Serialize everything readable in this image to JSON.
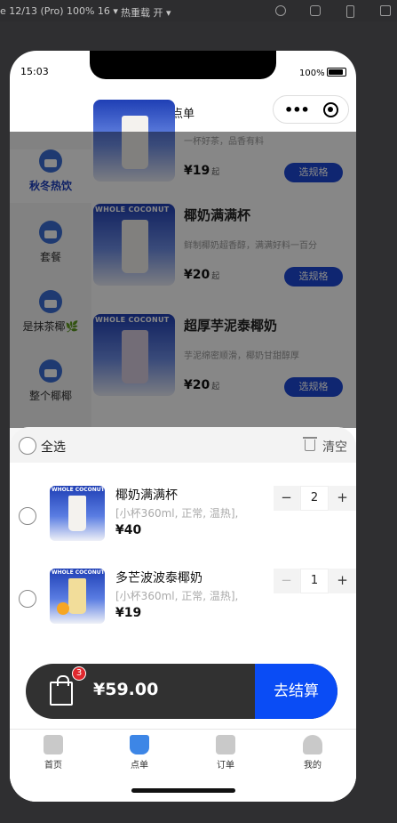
{
  "devtools": {
    "device": "e 12/13 (Pro) 100% 16 ▾",
    "hotreload": "热重载 开 ▾"
  },
  "status": {
    "time": "15:03",
    "battery": "100%"
  },
  "nav": {
    "title": "点单"
  },
  "categories": [
    {
      "label": "秋冬热饮",
      "active": true
    },
    {
      "label": "套餐",
      "active": false
    },
    {
      "label": "是抹茶椰🌿",
      "active": false
    },
    {
      "label": "整个椰椰",
      "active": false
    }
  ],
  "products": [
    {
      "name": "",
      "desc": "一杯好茶，品香有料",
      "price": "¥19",
      "price_suffix": "起",
      "spec": "选规格",
      "brand": ""
    },
    {
      "name": "椰奶满满杯",
      "desc": "鲜制椰奶超香醇，满满好料一百分",
      "price": "¥20",
      "price_suffix": "起",
      "spec": "选规格",
      "brand": "WHOLE COCONUT"
    },
    {
      "name": "超厚芋泥泰椰奶",
      "desc": "芋泥绵密顺滑，椰奶甘甜醇厚",
      "price": "¥20",
      "price_suffix": "起",
      "spec": "选规格",
      "brand": "WHOLE COCONUT"
    }
  ],
  "cart": {
    "select_all": "全选",
    "clear": "清空",
    "items": [
      {
        "name": "椰奶满满杯",
        "spec": "[小杯360ml, 正常, 温热],",
        "price": "¥40",
        "qty": "2",
        "brand": "WHOLE COCONUT"
      },
      {
        "name": "多芒波波泰椰奶",
        "spec": "[小杯360ml, 正常, 温热],",
        "price": "¥19",
        "qty": "1",
        "brand": "WHOLE COCONUT"
      }
    ],
    "stepper": {
      "minus": "−",
      "plus": "+"
    },
    "badge": "3",
    "total": "¥59.00",
    "checkout": "去结算"
  },
  "tabs": [
    {
      "label": "首页",
      "icon": "home-icon",
      "active": false
    },
    {
      "label": "点单",
      "icon": "drink-icon",
      "active": true
    },
    {
      "label": "订单",
      "icon": "order-icon",
      "active": false
    },
    {
      "label": "我的",
      "icon": "user-icon",
      "active": false
    }
  ],
  "colors": {
    "accent": "#0a4cf5",
    "spec_button": "#1d48d6",
    "badge": "#e0282e",
    "checkout_bar": "#313131"
  }
}
